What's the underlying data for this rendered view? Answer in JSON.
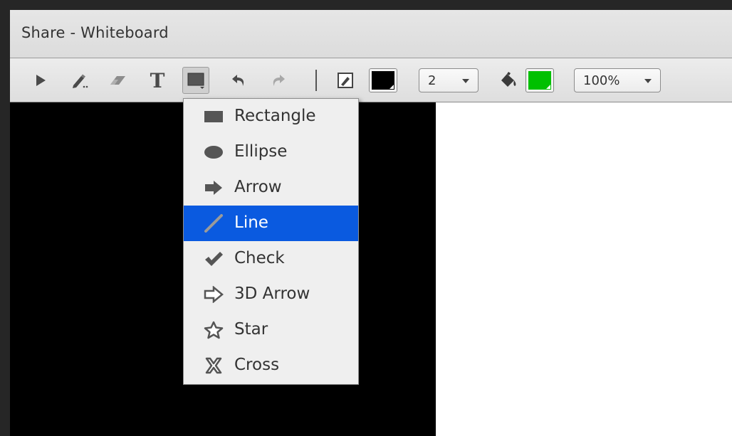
{
  "window": {
    "title": "Share - Whiteboard"
  },
  "toolbar": {
    "tools": [
      {
        "name": "selection-tool",
        "icon": "pointer-icon"
      },
      {
        "name": "pencil-tool",
        "icon": "pencil-icon"
      },
      {
        "name": "eraser-tool",
        "icon": "eraser-icon"
      },
      {
        "name": "text-tool",
        "icon": "text-icon",
        "glyph": "T"
      },
      {
        "name": "shapes-tool",
        "icon": "rectangle-shape-icon",
        "active": true
      },
      {
        "name": "undo-button",
        "icon": "undo-icon"
      },
      {
        "name": "redo-button",
        "icon": "redo-icon",
        "disabled": true
      }
    ],
    "stroke_color": "#000000",
    "stroke_width": "2",
    "fill_color": "#00c000",
    "zoom": "100%"
  },
  "shape_menu": {
    "items": [
      {
        "label": "Rectangle",
        "icon": "rectangle-icon"
      },
      {
        "label": "Ellipse",
        "icon": "ellipse-icon"
      },
      {
        "label": "Arrow",
        "icon": "arrow-icon"
      },
      {
        "label": "Line",
        "icon": "line-icon",
        "selected": true
      },
      {
        "label": "Check",
        "icon": "check-icon"
      },
      {
        "label": "3D Arrow",
        "icon": "3d-arrow-icon"
      },
      {
        "label": "Star",
        "icon": "star-icon"
      },
      {
        "label": "Cross",
        "icon": "cross-icon"
      }
    ]
  },
  "colors": {
    "menu_highlight": "#0a5ae0",
    "canvas_dark": "#000000",
    "canvas_light": "#ffffff"
  }
}
